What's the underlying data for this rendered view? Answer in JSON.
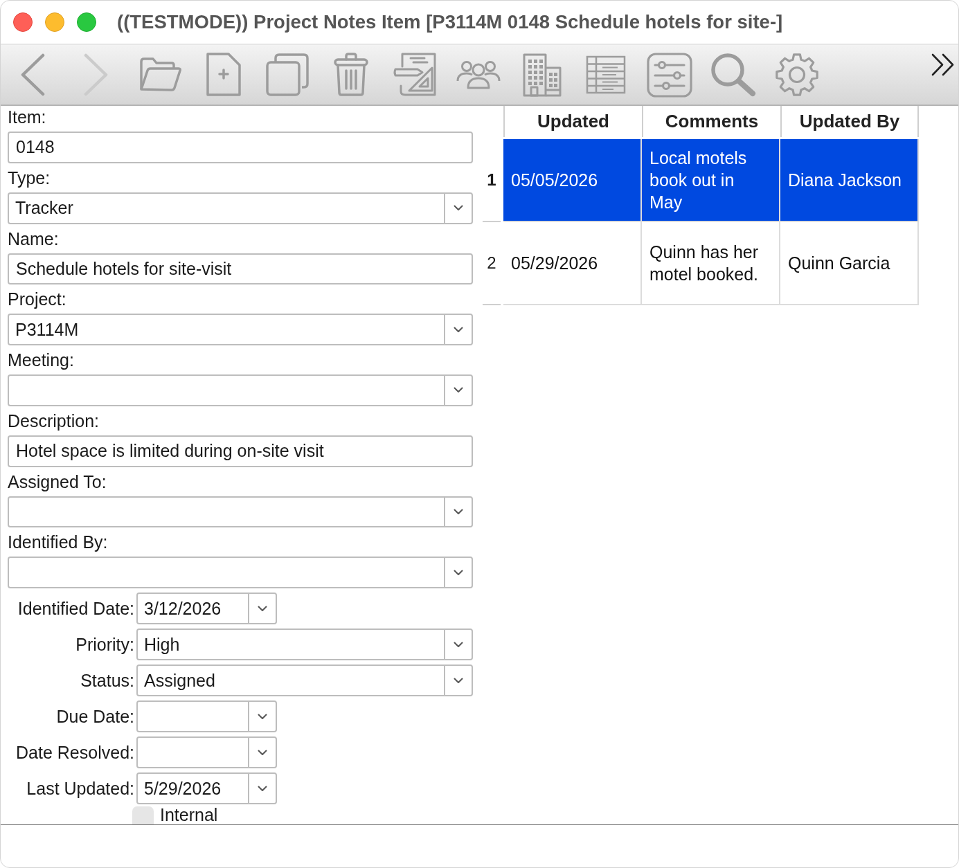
{
  "window": {
    "title": "((TESTMODE)) Project Notes Item [P3114M 0148 Schedule hotels for site-]"
  },
  "toolbar": {
    "buttons": [
      {
        "kind": "back",
        "disabled": false
      },
      {
        "kind": "forward",
        "disabled": true
      },
      {
        "kind": "open",
        "disabled": false
      },
      {
        "kind": "new",
        "disabled": false
      },
      {
        "kind": "duplicate",
        "disabled": false
      },
      {
        "kind": "delete",
        "disabled": false
      },
      {
        "kind": "drafting",
        "disabled": false
      },
      {
        "kind": "people",
        "disabled": false
      },
      {
        "kind": "building",
        "disabled": false
      },
      {
        "kind": "table",
        "disabled": false
      },
      {
        "kind": "sliders",
        "disabled": false
      },
      {
        "kind": "search",
        "disabled": false
      },
      {
        "kind": "settings",
        "disabled": false
      }
    ]
  },
  "form": {
    "stacked_fields": [
      {
        "label": "Item:",
        "kind": "text",
        "value": "0148"
      },
      {
        "label": "Type:",
        "kind": "dropdown",
        "value": "Tracker"
      },
      {
        "label": "Name:",
        "kind": "text",
        "value": "Schedule hotels for site-visit"
      },
      {
        "label": "Project:",
        "kind": "dropdown",
        "value": "P3114M"
      },
      {
        "label": "Meeting:",
        "kind": "dropdown"
      },
      {
        "label": "Description:",
        "kind": "text",
        "value": "Hotel space is limited during on-site visit"
      },
      {
        "label": "Assigned To:",
        "kind": "dropdown"
      },
      {
        "label": "Identified By:",
        "kind": "dropdown"
      }
    ],
    "inline_fields": [
      {
        "label": "Identified Date:",
        "kind": "date",
        "value": "3/12/2026"
      },
      {
        "label": "Priority:",
        "kind": "dropdown",
        "value": "High"
      },
      {
        "label": "Status:",
        "kind": "dropdown",
        "value": "Assigned"
      },
      {
        "label": "Due Date:",
        "kind": "date"
      },
      {
        "label": "Date Resolved:",
        "kind": "date"
      },
      {
        "label": "Last Updated:",
        "kind": "date",
        "value": "5/29/2026"
      }
    ],
    "checkbox": {
      "label": "Internal",
      "checked": false
    }
  },
  "table": {
    "columns": [
      "Updated",
      "Comments",
      "Updated By"
    ],
    "rows": [
      {
        "number": "1",
        "selected": true,
        "cells": [
          "05/05/2026",
          "Local motels book out in May",
          "Diana Jackson"
        ]
      },
      {
        "number": "2",
        "selected": false,
        "cells": [
          "05/29/2026",
          "Quinn has her motel booked.",
          "Quinn Garcia"
        ]
      }
    ]
  }
}
